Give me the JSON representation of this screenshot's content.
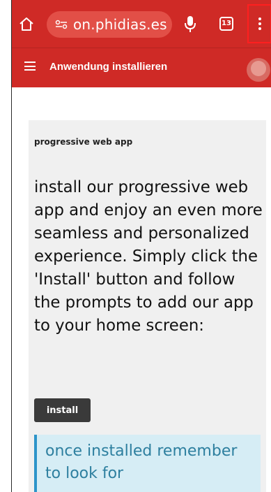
{
  "browser": {
    "url_text": "on.phidias.es",
    "tab_count": "13",
    "colors": {
      "toolbar": "#cf2a26",
      "menu_highlight": "#ff1f1f"
    },
    "icons": {
      "home": "home-icon",
      "site_info": "site-info-icon",
      "mic": "mic-icon",
      "tabs": "tabs-icon",
      "menu": "more-vert-icon"
    }
  },
  "app": {
    "title": "Anwendung installieren"
  },
  "content": {
    "kicker": "progressive web app",
    "body": "install our progressive web app and enjoy an even more seamless and personalized experience. Simply click the 'Install' button and follow the prompts to add our app to your home screen:",
    "install_label": "install",
    "note": "once installed remember to look for"
  }
}
